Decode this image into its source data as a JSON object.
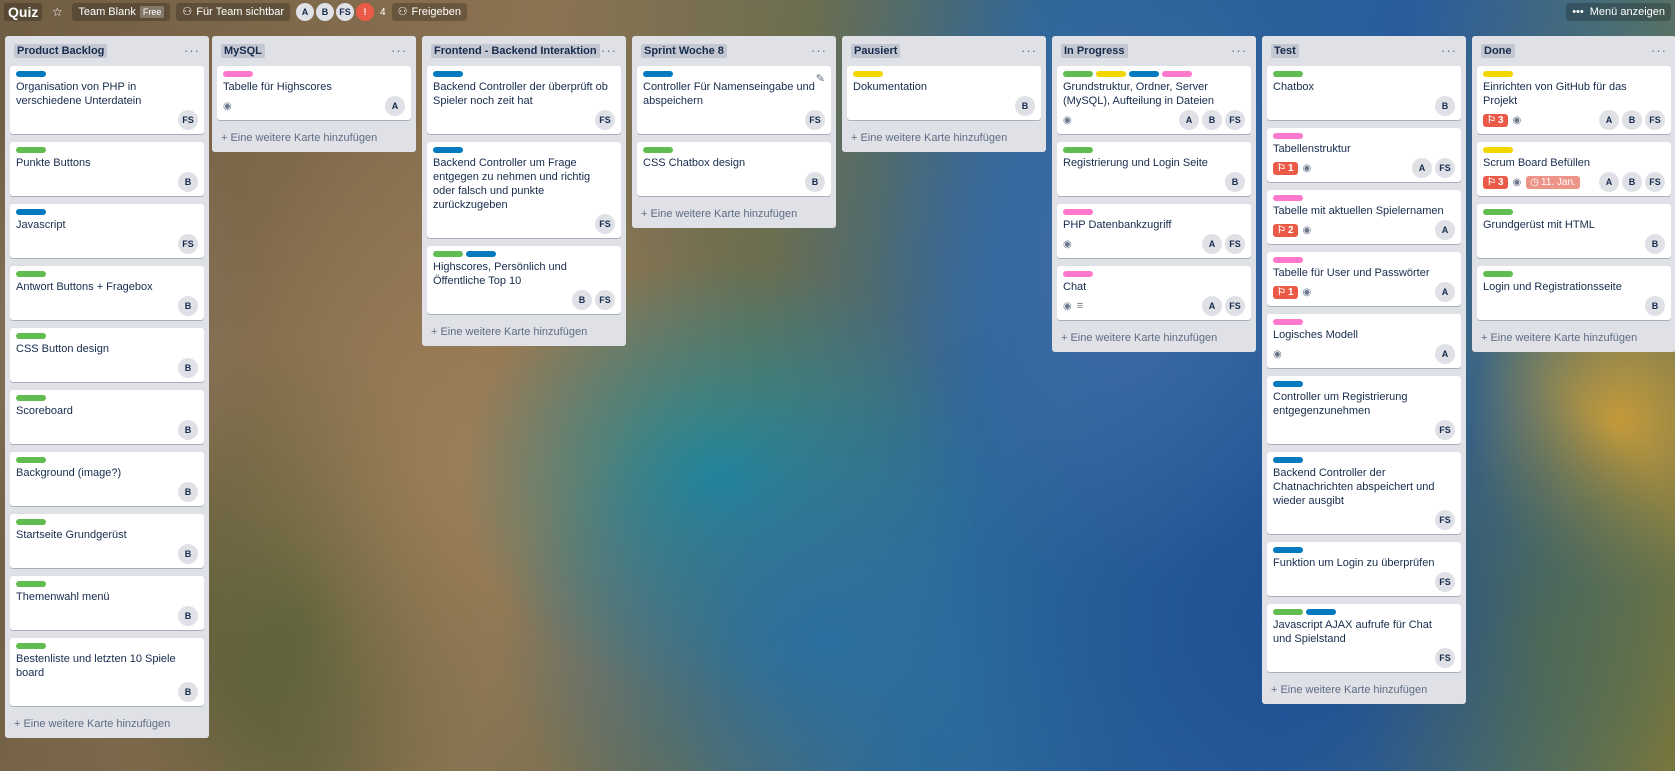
{
  "header": {
    "board_name": "Quiz",
    "team": "Team Blank",
    "team_badge": "Free",
    "visibility": "Für Team sichtbar",
    "members": [
      "A",
      "B",
      "FS"
    ],
    "member_count": "4",
    "share": "Freigeben",
    "menu": "Menü anzeigen"
  },
  "colors": {
    "green": "#61bd4f",
    "blue": "#0079bf",
    "yellow": "#f2d600",
    "pink": "#ff78cb",
    "red": "#eb5a46"
  },
  "add_card_text": "Eine weitere Karte hinzufügen",
  "lists": [
    {
      "title": "Product Backlog",
      "cards": [
        {
          "labels": [
            "blue"
          ],
          "title": "Organisation von PHP in verschiedene Unterdatein",
          "members": [
            "FS"
          ]
        },
        {
          "labels": [
            "green"
          ],
          "title": "Punkte Buttons",
          "members": [
            "B"
          ]
        },
        {
          "labels": [
            "blue"
          ],
          "title": "Javascript",
          "members": [
            "FS"
          ]
        },
        {
          "labels": [
            "green"
          ],
          "title": "Antwort Buttons + Fragebox",
          "members": [
            "B"
          ]
        },
        {
          "labels": [
            "green"
          ],
          "title": "CSS Button design",
          "members": [
            "B"
          ]
        },
        {
          "labels": [
            "green"
          ],
          "title": "Scoreboard",
          "members": [
            "B"
          ]
        },
        {
          "labels": [
            "green"
          ],
          "title": "Background (image?)",
          "members": [
            "B"
          ]
        },
        {
          "labels": [
            "green"
          ],
          "title": "Startseite Grundgerüst",
          "members": [
            "B"
          ]
        },
        {
          "labels": [
            "green"
          ],
          "title": "Themenwahl menü",
          "members": [
            "B"
          ]
        },
        {
          "labels": [
            "green"
          ],
          "title": "Bestenliste und letzten 10 Spiele board",
          "members": [
            "B"
          ]
        }
      ]
    },
    {
      "title": "MySQL",
      "cards": [
        {
          "labels": [
            "pink"
          ],
          "title": "Tabelle für Highscores",
          "watch": true,
          "members": [
            "A"
          ]
        }
      ]
    },
    {
      "title": "Frontend - Backend Interaktion",
      "cards": [
        {
          "labels": [
            "blue"
          ],
          "title": "Backend Controller der überprüft ob Spieler noch zeit hat",
          "members": [
            "FS"
          ]
        },
        {
          "labels": [
            "blue"
          ],
          "title": "Backend Controller um Frage entgegen zu nehmen und richtig oder falsch und punkte zurückzugeben",
          "members": [
            "FS"
          ]
        },
        {
          "labels": [
            "green",
            "blue"
          ],
          "title": "Highscores, Persönlich und Öffentliche Top 10",
          "members": [
            "B",
            "FS"
          ]
        }
      ]
    },
    {
      "title": "Sprint Woche 8",
      "cards": [
        {
          "labels": [
            "blue"
          ],
          "title": "Controller Für Namenseingabe und abspeichern",
          "members": [
            "FS"
          ],
          "editing": true
        },
        {
          "labels": [
            "green"
          ],
          "title": "CSS Chatbox design",
          "members": [
            "B"
          ]
        }
      ]
    },
    {
      "title": "Pausiert",
      "cards": [
        {
          "labels": [
            "yellow"
          ],
          "title": "Dokumentation",
          "members": [
            "B"
          ]
        }
      ]
    },
    {
      "title": "In Progress",
      "cards": [
        {
          "labels": [
            "green",
            "yellow",
            "blue",
            "pink"
          ],
          "title": "Grundstruktur, Ordner, Server (MySQL), Aufteilung in Dateien",
          "watch": true,
          "members": [
            "A",
            "B",
            "FS"
          ]
        },
        {
          "labels": [
            "green"
          ],
          "title": "Registrierung und Login Seite",
          "members": [
            "B"
          ]
        },
        {
          "labels": [
            "pink"
          ],
          "title": "PHP Datenbankzugriff",
          "watch": true,
          "members": [
            "A",
            "FS"
          ]
        },
        {
          "labels": [
            "pink"
          ],
          "title": "Chat",
          "watch": true,
          "description": true,
          "members": [
            "A",
            "FS"
          ]
        }
      ]
    },
    {
      "title": "Test",
      "cards": [
        {
          "labels": [
            "green"
          ],
          "title": "Chatbox",
          "members": [
            "B"
          ]
        },
        {
          "labels": [
            "pink"
          ],
          "title": "Tabellenstruktur",
          "notif": "1",
          "watch": true,
          "members": [
            "A",
            "FS"
          ]
        },
        {
          "labels": [
            "pink"
          ],
          "title": "Tabelle mit aktuellen Spielernamen",
          "notif": "2",
          "watch": true,
          "members": [
            "A"
          ]
        },
        {
          "labels": [
            "pink"
          ],
          "title": "Tabelle für User und Passwörter",
          "notif": "1",
          "watch": true,
          "members": [
            "A"
          ]
        },
        {
          "labels": [
            "pink"
          ],
          "title": "Logisches Modell",
          "watch": true,
          "members": [
            "A"
          ]
        },
        {
          "labels": [
            "blue"
          ],
          "title": "Controller um Registrierung entgegenzunehmen",
          "members": [
            "FS"
          ]
        },
        {
          "labels": [
            "blue"
          ],
          "title": "Backend Controller der Chatnachrichten abspeichert und wieder ausgibt",
          "members": [
            "FS"
          ]
        },
        {
          "labels": [
            "blue"
          ],
          "title": "Funktion um Login zu überprüfen",
          "members": [
            "FS"
          ]
        },
        {
          "labels": [
            "green",
            "blue"
          ],
          "title": "Javascript AJAX aufrufe für Chat und Spielstand",
          "members": [
            "FS"
          ]
        }
      ]
    },
    {
      "title": "Done",
      "cards": [
        {
          "labels": [
            "yellow"
          ],
          "title": "Einrichten von GitHub für das Projekt",
          "notif": "3",
          "watch": true,
          "members": [
            "A",
            "B",
            "FS"
          ]
        },
        {
          "labels": [
            "yellow"
          ],
          "title": "Scrum Board Befüllen",
          "notif": "3",
          "watch": true,
          "due": "11. Jan.",
          "members": [
            "A",
            "B",
            "FS"
          ]
        },
        {
          "labels": [
            "green"
          ],
          "title": "Grundgerüst mit HTML",
          "members": [
            "B"
          ]
        },
        {
          "labels": [
            "green"
          ],
          "title": "Login und Registrationsseite",
          "members": [
            "B"
          ]
        }
      ]
    }
  ]
}
